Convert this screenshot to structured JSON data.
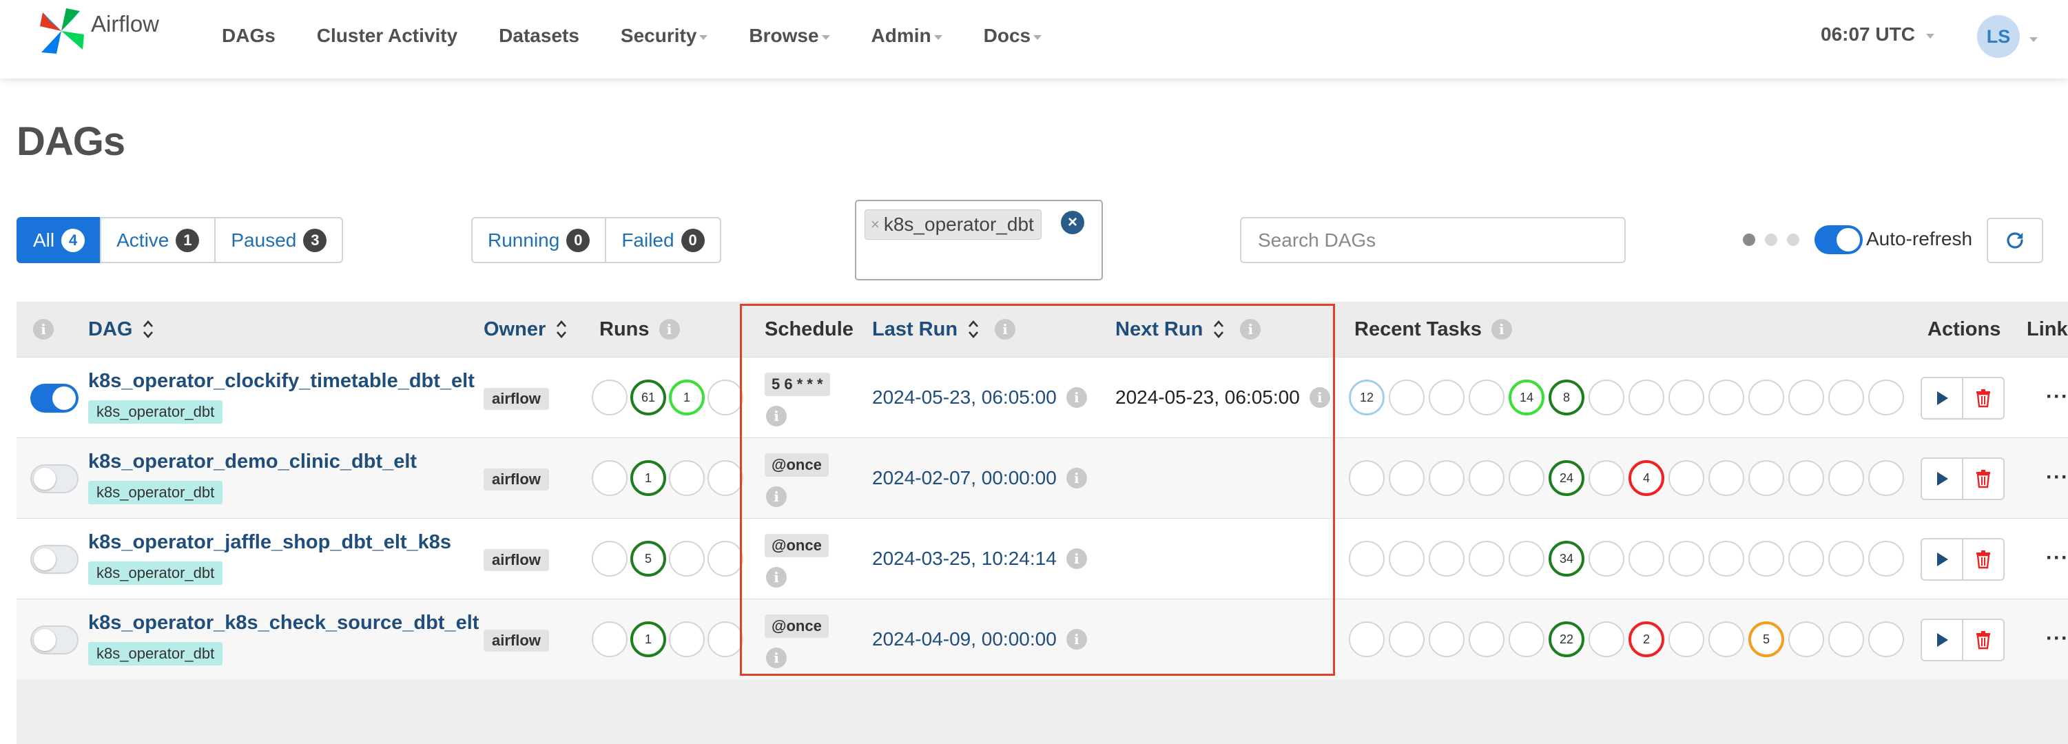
{
  "navbar": {
    "brand": "Airflow",
    "items": [
      {
        "label": "DAGs",
        "caret": false
      },
      {
        "label": "Cluster Activity",
        "caret": false
      },
      {
        "label": "Datasets",
        "caret": false
      },
      {
        "label": "Security",
        "caret": true
      },
      {
        "label": "Browse",
        "caret": true
      },
      {
        "label": "Admin",
        "caret": true
      },
      {
        "label": "Docs",
        "caret": true
      }
    ],
    "time": "06:07 UTC",
    "user_initials": "LS"
  },
  "page_title": "DAGs",
  "status_filters": [
    {
      "label": "All",
      "count": "4",
      "active": true
    },
    {
      "label": "Active",
      "count": "1",
      "active": false
    },
    {
      "label": "Paused",
      "count": "3",
      "active": false
    }
  ],
  "run_filters": [
    {
      "label": "Running",
      "count": "0"
    },
    {
      "label": "Failed",
      "count": "0"
    }
  ],
  "tag_filter": {
    "selected_tag": "k8s_operator_dbt",
    "remove_glyph": "×",
    "clear_glyph": "×"
  },
  "search": {
    "placeholder": "Search DAGs"
  },
  "auto_refresh": {
    "label": "Auto-refresh",
    "enabled": true
  },
  "table": {
    "headers": {
      "dag": "DAG",
      "owner": "Owner",
      "runs": "Runs",
      "schedule": "Schedule",
      "last_run": "Last Run",
      "next_run": "Next Run",
      "recent_tasks": "Recent Tasks",
      "actions": "Actions",
      "links": "Links"
    },
    "info_glyph": "i",
    "more_glyph": "···",
    "rows": [
      {
        "name": "k8s_operator_clockify_timetable_dbt_elt",
        "tag": "k8s_operator_dbt",
        "owner": "airflow",
        "active": true,
        "runs": [
          {
            "state": "none",
            "count": ""
          },
          {
            "state": "success",
            "count": "61"
          },
          {
            "state": "running",
            "count": "1"
          },
          {
            "state": "none",
            "count": ""
          }
        ],
        "schedule": "5 6 * * *",
        "last_run": "2024-05-23, 06:05:00",
        "next_run": "2024-05-23, 06:05:00",
        "recent_tasks": [
          {
            "state": "upstream",
            "count": "12"
          },
          {
            "state": "none",
            "count": ""
          },
          {
            "state": "none",
            "count": ""
          },
          {
            "state": "none",
            "count": ""
          },
          {
            "state": "running",
            "count": "14"
          },
          {
            "state": "success",
            "count": "8"
          },
          {
            "state": "none",
            "count": ""
          },
          {
            "state": "none",
            "count": ""
          },
          {
            "state": "none",
            "count": ""
          },
          {
            "state": "none",
            "count": ""
          },
          {
            "state": "none",
            "count": ""
          },
          {
            "state": "none",
            "count": ""
          },
          {
            "state": "none",
            "count": ""
          },
          {
            "state": "none",
            "count": ""
          }
        ]
      },
      {
        "name": "k8s_operator_demo_clinic_dbt_elt",
        "tag": "k8s_operator_dbt",
        "owner": "airflow",
        "active": false,
        "runs": [
          {
            "state": "none",
            "count": ""
          },
          {
            "state": "success",
            "count": "1"
          },
          {
            "state": "none",
            "count": ""
          },
          {
            "state": "none",
            "count": ""
          }
        ],
        "schedule": "@once",
        "last_run": "2024-02-07, 00:00:00",
        "next_run": "",
        "recent_tasks": [
          {
            "state": "none",
            "count": ""
          },
          {
            "state": "none",
            "count": ""
          },
          {
            "state": "none",
            "count": ""
          },
          {
            "state": "none",
            "count": ""
          },
          {
            "state": "none",
            "count": ""
          },
          {
            "state": "success",
            "count": "24"
          },
          {
            "state": "none",
            "count": ""
          },
          {
            "state": "failed",
            "count": "4"
          },
          {
            "state": "none",
            "count": ""
          },
          {
            "state": "none",
            "count": ""
          },
          {
            "state": "none",
            "count": ""
          },
          {
            "state": "none",
            "count": ""
          },
          {
            "state": "none",
            "count": ""
          },
          {
            "state": "none",
            "count": ""
          }
        ]
      },
      {
        "name": "k8s_operator_jaffle_shop_dbt_elt_k8s",
        "tag": "k8s_operator_dbt",
        "owner": "airflow",
        "active": false,
        "runs": [
          {
            "state": "none",
            "count": ""
          },
          {
            "state": "success",
            "count": "5"
          },
          {
            "state": "none",
            "count": ""
          },
          {
            "state": "none",
            "count": ""
          }
        ],
        "schedule": "@once",
        "last_run": "2024-03-25, 10:24:14",
        "next_run": "",
        "recent_tasks": [
          {
            "state": "none",
            "count": ""
          },
          {
            "state": "none",
            "count": ""
          },
          {
            "state": "none",
            "count": ""
          },
          {
            "state": "none",
            "count": ""
          },
          {
            "state": "none",
            "count": ""
          },
          {
            "state": "success",
            "count": "34"
          },
          {
            "state": "none",
            "count": ""
          },
          {
            "state": "none",
            "count": ""
          },
          {
            "state": "none",
            "count": ""
          },
          {
            "state": "none",
            "count": ""
          },
          {
            "state": "none",
            "count": ""
          },
          {
            "state": "none",
            "count": ""
          },
          {
            "state": "none",
            "count": ""
          },
          {
            "state": "none",
            "count": ""
          }
        ]
      },
      {
        "name": "k8s_operator_k8s_check_source_dbt_elt",
        "tag": "k8s_operator_dbt",
        "owner": "airflow",
        "active": false,
        "runs": [
          {
            "state": "none",
            "count": ""
          },
          {
            "state": "success",
            "count": "1"
          },
          {
            "state": "none",
            "count": ""
          },
          {
            "state": "none",
            "count": ""
          }
        ],
        "schedule": "@once",
        "last_run": "2024-04-09, 00:00:00",
        "next_run": "",
        "recent_tasks": [
          {
            "state": "none",
            "count": ""
          },
          {
            "state": "none",
            "count": ""
          },
          {
            "state": "none",
            "count": ""
          },
          {
            "state": "none",
            "count": ""
          },
          {
            "state": "none",
            "count": ""
          },
          {
            "state": "success",
            "count": "22"
          },
          {
            "state": "none",
            "count": ""
          },
          {
            "state": "failed",
            "count": "2"
          },
          {
            "state": "none",
            "count": ""
          },
          {
            "state": "none",
            "count": ""
          },
          {
            "state": "queued",
            "count": "5"
          },
          {
            "state": "none",
            "count": ""
          },
          {
            "state": "none",
            "count": ""
          },
          {
            "state": "none",
            "count": ""
          }
        ]
      }
    ]
  },
  "colors": {
    "primary": "#1a73d8",
    "link": "#1f4e7a",
    "success": "#1e7d1e",
    "running": "#3adf3a",
    "failed": "#e22",
    "queued": "#f0a020",
    "tag_bg": "#b8ece8",
    "annotation_box": "#e0402a"
  }
}
